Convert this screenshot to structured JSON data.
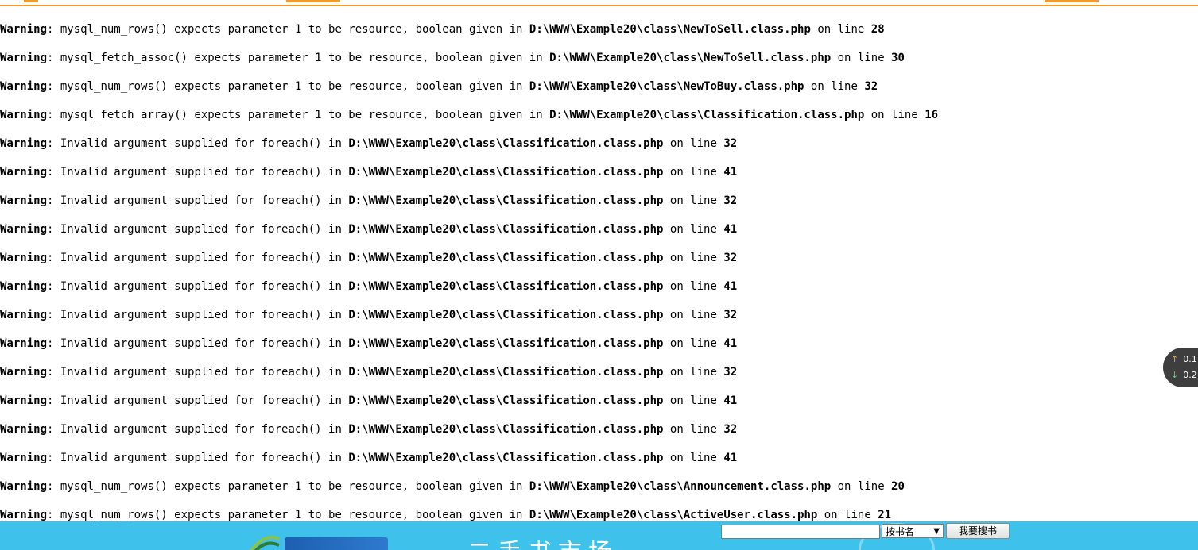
{
  "warnings": [
    {
      "label": "Warning",
      "msg": ": mysql_num_rows() expects parameter 1 to be resource, boolean given in ",
      "path": "D:\\WWW\\Example20\\class\\NewToSell.class.php",
      "on": " on line ",
      "line": "28"
    },
    {
      "label": "Warning",
      "msg": ": mysql_fetch_assoc() expects parameter 1 to be resource, boolean given in ",
      "path": "D:\\WWW\\Example20\\class\\NewToSell.class.php",
      "on": " on line ",
      "line": "30"
    },
    {
      "label": "Warning",
      "msg": ": mysql_num_rows() expects parameter 1 to be resource, boolean given in ",
      "path": "D:\\WWW\\Example20\\class\\NewToBuy.class.php",
      "on": " on line ",
      "line": "32"
    },
    {
      "label": "Warning",
      "msg": ": mysql_fetch_array() expects parameter 1 to be resource, boolean given in ",
      "path": "D:\\WWW\\Example20\\class\\Classification.class.php",
      "on": " on line ",
      "line": "16"
    },
    {
      "label": "Warning",
      "msg": ": Invalid argument supplied for foreach() in ",
      "path": "D:\\WWW\\Example20\\class\\Classification.class.php",
      "on": " on line ",
      "line": "32"
    },
    {
      "label": "Warning",
      "msg": ": Invalid argument supplied for foreach() in ",
      "path": "D:\\WWW\\Example20\\class\\Classification.class.php",
      "on": " on line ",
      "line": "41"
    },
    {
      "label": "Warning",
      "msg": ": Invalid argument supplied for foreach() in ",
      "path": "D:\\WWW\\Example20\\class\\Classification.class.php",
      "on": " on line ",
      "line": "32"
    },
    {
      "label": "Warning",
      "msg": ": Invalid argument supplied for foreach() in ",
      "path": "D:\\WWW\\Example20\\class\\Classification.class.php",
      "on": " on line ",
      "line": "41"
    },
    {
      "label": "Warning",
      "msg": ": Invalid argument supplied for foreach() in ",
      "path": "D:\\WWW\\Example20\\class\\Classification.class.php",
      "on": " on line ",
      "line": "32"
    },
    {
      "label": "Warning",
      "msg": ": Invalid argument supplied for foreach() in ",
      "path": "D:\\WWW\\Example20\\class\\Classification.class.php",
      "on": " on line ",
      "line": "41"
    },
    {
      "label": "Warning",
      "msg": ": Invalid argument supplied for foreach() in ",
      "path": "D:\\WWW\\Example20\\class\\Classification.class.php",
      "on": " on line ",
      "line": "32"
    },
    {
      "label": "Warning",
      "msg": ": Invalid argument supplied for foreach() in ",
      "path": "D:\\WWW\\Example20\\class\\Classification.class.php",
      "on": " on line ",
      "line": "41"
    },
    {
      "label": "Warning",
      "msg": ": Invalid argument supplied for foreach() in ",
      "path": "D:\\WWW\\Example20\\class\\Classification.class.php",
      "on": " on line ",
      "line": "32"
    },
    {
      "label": "Warning",
      "msg": ": Invalid argument supplied for foreach() in ",
      "path": "D:\\WWW\\Example20\\class\\Classification.class.php",
      "on": " on line ",
      "line": "41"
    },
    {
      "label": "Warning",
      "msg": ": Invalid argument supplied for foreach() in ",
      "path": "D:\\WWW\\Example20\\class\\Classification.class.php",
      "on": " on line ",
      "line": "32"
    },
    {
      "label": "Warning",
      "msg": ": Invalid argument supplied for foreach() in ",
      "path": "D:\\WWW\\Example20\\class\\Classification.class.php",
      "on": " on line ",
      "line": "41"
    },
    {
      "label": "Warning",
      "msg": ": mysql_num_rows() expects parameter 1 to be resource, boolean given in ",
      "path": "D:\\WWW\\Example20\\class\\Announcement.class.php",
      "on": " on line ",
      "line": "20"
    },
    {
      "label": "Warning",
      "msg": ": mysql_num_rows() expects parameter 1 to be resource, boolean given in ",
      "path": "D:\\WWW\\Example20\\class\\ActiveUser.class.php",
      "on": " on line ",
      "line": "21"
    }
  ],
  "speed_widget": {
    "up_icon": "arrow-up-icon",
    "down_icon": "arrow-down-icon",
    "up_value": "0.1",
    "down_value": "0.2"
  },
  "banner": {
    "title": "二手书市场"
  },
  "search": {
    "input_value": "",
    "select_value": "按书名",
    "button_label": "我要搜书"
  },
  "colors": {
    "accent_orange": "#f39a2a",
    "banner_blue": "#3ec2ec"
  }
}
